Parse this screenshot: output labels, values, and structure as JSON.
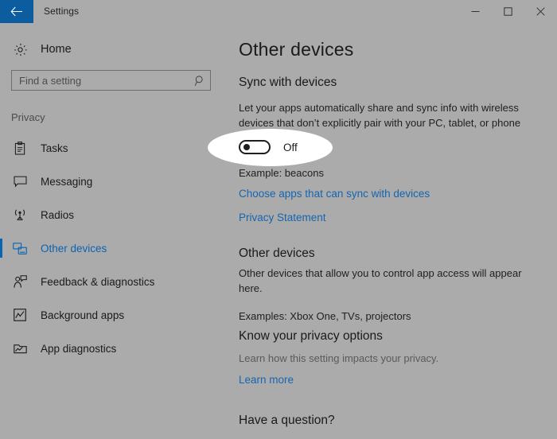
{
  "window": {
    "title": "Settings",
    "back_icon": "back-arrow-icon",
    "controls": {
      "minimize": "minimize-icon",
      "maximize": "maximize-icon",
      "close": "close-icon"
    }
  },
  "sidebar": {
    "home_label": "Home",
    "home_icon": "gear-icon",
    "search": {
      "placeholder": "Find a setting",
      "value": "",
      "icon": "search-icon"
    },
    "section_label": "Privacy",
    "items": [
      {
        "label": "Tasks",
        "icon": "clipboard-icon",
        "selected": false
      },
      {
        "label": "Messaging",
        "icon": "speech-bubble-icon",
        "selected": false
      },
      {
        "label": "Radios",
        "icon": "radio-tower-icon",
        "selected": false
      },
      {
        "label": "Other devices",
        "icon": "devices-icon",
        "selected": true
      },
      {
        "label": "Feedback & diagnostics",
        "icon": "person-feedback-icon",
        "selected": false
      },
      {
        "label": "Background apps",
        "icon": "chart-window-icon",
        "selected": false
      },
      {
        "label": "App diagnostics",
        "icon": "app-diagnostics-icon",
        "selected": false
      }
    ]
  },
  "main": {
    "page_title": "Other devices",
    "sync_section": {
      "heading": "Sync with devices",
      "description": "Let your apps automatically share and sync info with wireless devices that don’t explicitly pair with your PC, tablet, or phone",
      "toggle_state": "Off",
      "example": "Example: beacons",
      "link_choose_apps": "Choose apps that can sync with devices",
      "link_privacy_statement": "Privacy Statement"
    },
    "devices_section": {
      "heading": "Other devices",
      "description": "Other devices that allow you to control app access will appear here.",
      "examples": "Examples: Xbox One, TVs, projectors"
    },
    "privacy_options_section": {
      "heading": "Know your privacy options",
      "description": "Learn how this setting impacts your privacy.",
      "link_learn_more": "Learn more"
    },
    "question_section": {
      "heading": "Have a question?"
    }
  },
  "colors": {
    "background": "#ababab",
    "accent_blue": "#0a64b0",
    "link_blue": "#1665b0",
    "titlebar_back": "#0c5ca0",
    "highlight": "#ffffff"
  }
}
